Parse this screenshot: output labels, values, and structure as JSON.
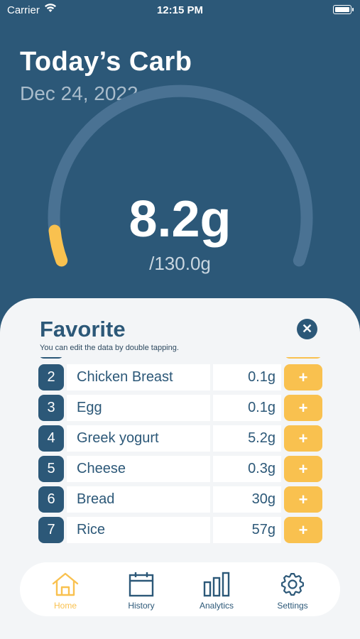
{
  "status_bar": {
    "carrier": "Carrier",
    "time": "12:15 PM"
  },
  "header": {
    "title": "Today’s Carb",
    "date": "Dec 24, 2022"
  },
  "gauge": {
    "value": "8.2g",
    "max": "/130.0g",
    "progress": 0.063,
    "track_color": "#4a7293",
    "fill_color": "#f9c14f"
  },
  "favorite": {
    "title": "Favorite",
    "subtitle": "You can edit the data by double tapping.",
    "add_label": "+",
    "items": [
      {
        "num": "2",
        "name": "Chicken Breast",
        "amount": "0.1g"
      },
      {
        "num": "3",
        "name": "Egg",
        "amount": "0.1g"
      },
      {
        "num": "4",
        "name": "Greek yogurt",
        "amount": "5.2g"
      },
      {
        "num": "5",
        "name": "Cheese",
        "amount": "0.3g"
      },
      {
        "num": "6",
        "name": "Bread",
        "amount": "30g"
      },
      {
        "num": "7",
        "name": "Rice",
        "amount": "57g"
      }
    ]
  },
  "tabs": [
    {
      "label": "Home",
      "icon": "home-icon",
      "active": true
    },
    {
      "label": "History",
      "icon": "calendar-icon",
      "active": false
    },
    {
      "label": "Analytics",
      "icon": "bar-chart-icon",
      "active": false
    },
    {
      "label": "Settings",
      "icon": "gear-icon",
      "active": false
    }
  ],
  "colors": {
    "background": "#2c5878",
    "accent": "#f9c14f",
    "sheet": "#f3f5f7"
  }
}
